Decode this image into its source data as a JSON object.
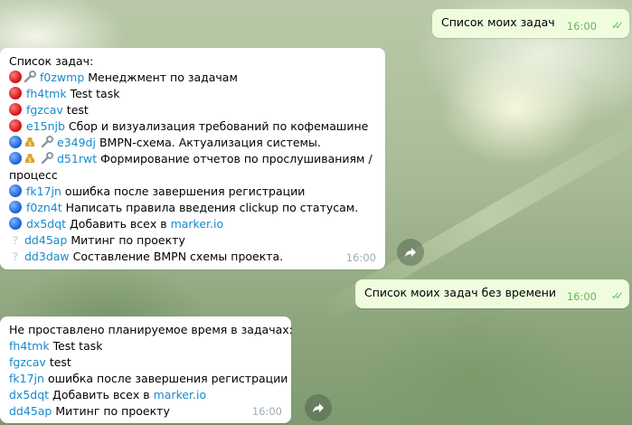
{
  "messages": {
    "out1": {
      "text": "Список моих задач",
      "time": "16:00"
    },
    "in1": {
      "title": "Список задач:",
      "time": "16:00",
      "tasks": [
        {
          "status": "red-circle-icon",
          "extra": "wrench-icon",
          "id": "f0zwmp",
          "text": "Менеджмент по задачам"
        },
        {
          "status": "red-circle-icon",
          "id": "fh4tmk",
          "text": "Test task"
        },
        {
          "status": "red-circle-icon",
          "id": "fgzcav",
          "text": "test"
        },
        {
          "status": "red-circle-icon",
          "id": "e15njb",
          "text": "Сбор и визуализация требований по кофемашине"
        },
        {
          "status": "blue-circle-icon",
          "extra": "money-bag-icon wrench-icon",
          "id": "e349dj",
          "text": "BMPN-схема. Актуализация системы."
        },
        {
          "status": "blue-circle-icon",
          "extra": "money-bag-icon wrench-icon",
          "id": "d51rwt",
          "text": "Формирование отчетов по прослушиваниям /",
          "text2": "процесс"
        },
        {
          "status": "blue-circle-icon",
          "id": "fk17jn",
          "text": "ошибка после завершения регистрации"
        },
        {
          "status": "blue-circle-icon",
          "id": "f0zn4t",
          "text": "Написать правила введения clickup по статусам."
        },
        {
          "status": "blue-circle-icon",
          "id": "dx5dqt",
          "text": "Добавить всех в",
          "link": "marker.io"
        },
        {
          "status": "question-mark-icon",
          "id": "dd45ap",
          "text": "Митинг по проекту"
        },
        {
          "status": "question-mark-icon",
          "id": "dd3daw",
          "text": "Составление BMPN схемы проекта."
        }
      ]
    },
    "out2": {
      "text": "Список моих задач без времени",
      "time": "16:00"
    },
    "in2": {
      "title": "Не проставлено планируемое время в задачах:",
      "time": "16:00",
      "tasks": [
        {
          "id": "fh4tmk",
          "text": "Test task"
        },
        {
          "id": "fgzcav",
          "text": "test"
        },
        {
          "id": "fk17jn",
          "text": "ошибка после завершения регистрации"
        },
        {
          "id": "dx5dqt",
          "text": "Добавить всех в",
          "link": "marker.io"
        },
        {
          "id": "dd45ap",
          "text": "Митинг по проекту"
        }
      ]
    }
  },
  "colors": {
    "link": "#168acd",
    "outgoing_bubble": "#effdde",
    "incoming_bubble": "#ffffff",
    "read_checks": "#5fbe67"
  }
}
